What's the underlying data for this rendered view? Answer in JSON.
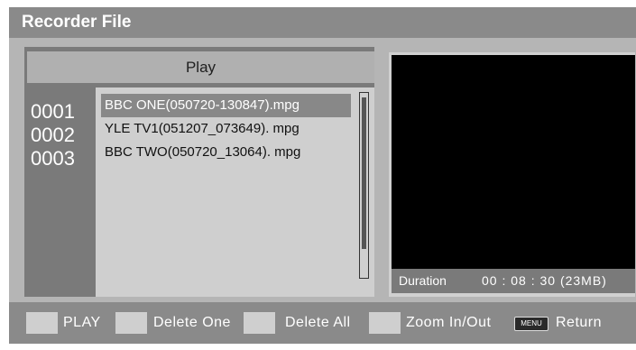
{
  "window": {
    "title": "Recorder File"
  },
  "list": {
    "header": "Play",
    "indices": [
      "0001",
      "0002",
      "0003"
    ],
    "files": [
      "BBC ONE(050720-130847).mpg",
      "YLE TV1(051207_073649). mpg",
      "BBC TWO(050720_13064). mpg"
    ],
    "selected_index": 0
  },
  "preview": {
    "duration_label": "Duration",
    "duration_value": "00 : 08 : 30 (23MB)"
  },
  "footer": {
    "play_label": "PLAY",
    "delete_one_label": "Delete One",
    "delete_all_label": "Delete All",
    "zoom_label": "Zoom In/Out",
    "menu_badge": "MENU",
    "return_label": "Return"
  }
}
